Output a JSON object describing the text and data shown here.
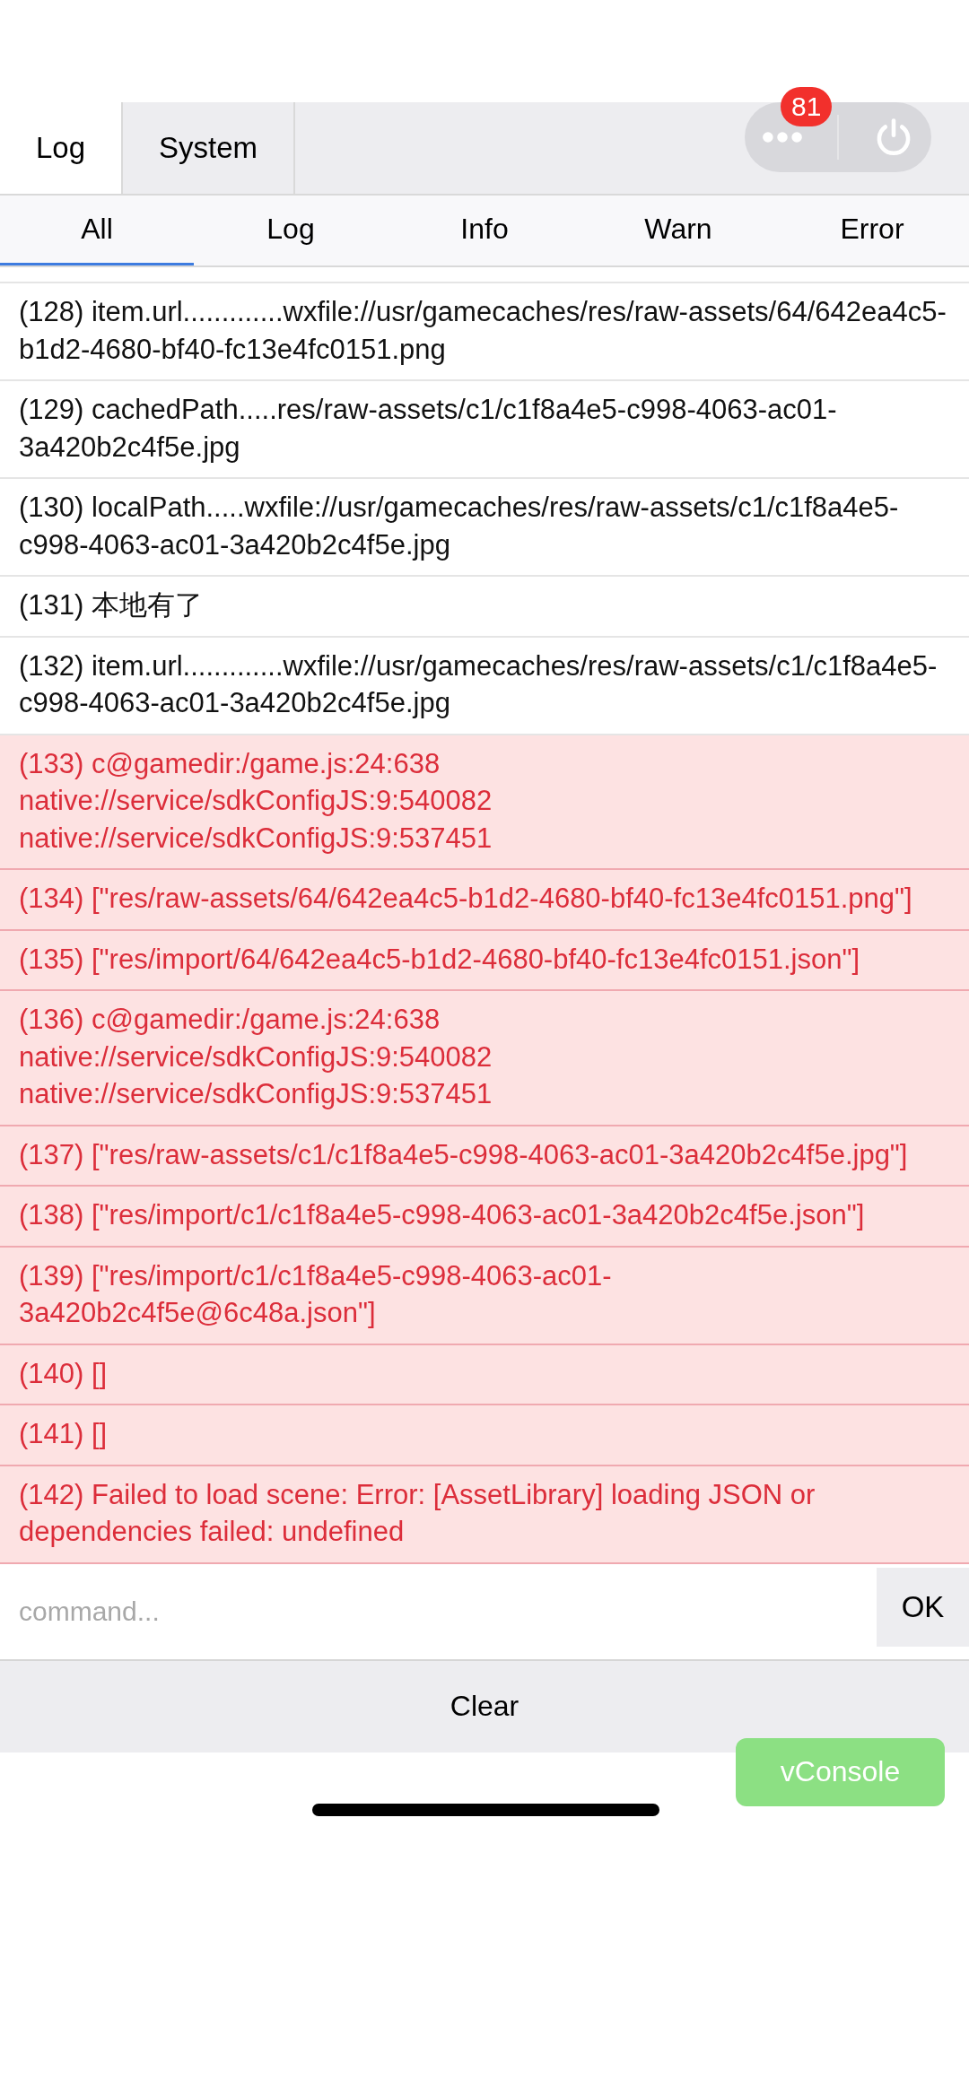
{
  "top_tabs": [
    {
      "label": "Log",
      "selected": true
    },
    {
      "label": "System",
      "selected": false
    }
  ],
  "badge": "81",
  "filter_tabs": [
    {
      "label": "All",
      "selected": true
    },
    {
      "label": "Log",
      "selected": false
    },
    {
      "label": "Info",
      "selected": false
    },
    {
      "label": "Warn",
      "selected": false
    },
    {
      "label": "Error",
      "selected": false
    }
  ],
  "log_entries": [
    {
      "kind": "log",
      "text": "(128) item.url.............wxfile://usr/gamecaches/res/raw-assets/64/642ea4c5-b1d2-4680-bf40-fc13e4fc0151.png"
    },
    {
      "kind": "log",
      "text": "(129) cachedPath.....res/raw-assets/c1/c1f8a4e5-c998-4063-ac01-3a420b2c4f5e.jpg"
    },
    {
      "kind": "log",
      "text": "(130) localPath.....wxfile://usr/gamecaches/res/raw-assets/c1/c1f8a4e5-c998-4063-ac01-3a420b2c4f5e.jpg"
    },
    {
      "kind": "log",
      "text": "(131) 本地有了"
    },
    {
      "kind": "log",
      "text": "(132) item.url.............wxfile://usr/gamecaches/res/raw-assets/c1/c1f8a4e5-c998-4063-ac01-3a420b2c4f5e.jpg"
    },
    {
      "kind": "error",
      "text": "(133) c@gamedir:/game.js:24:638\nnative://service/sdkConfigJS:9:540082\nnative://service/sdkConfigJS:9:537451"
    },
    {
      "kind": "error",
      "text": "(134) [\"res/raw-assets/64/642ea4c5-b1d2-4680-bf40-fc13e4fc0151.png\"]"
    },
    {
      "kind": "error",
      "text": "(135) [\"res/import/64/642ea4c5-b1d2-4680-bf40-fc13e4fc0151.json\"]"
    },
    {
      "kind": "error",
      "text": "(136) c@gamedir:/game.js:24:638\nnative://service/sdkConfigJS:9:540082\nnative://service/sdkConfigJS:9:537451"
    },
    {
      "kind": "error",
      "text": "(137) [\"res/raw-assets/c1/c1f8a4e5-c998-4063-ac01-3a420b2c4f5e.jpg\"]"
    },
    {
      "kind": "error",
      "text": "(138) [\"res/import/c1/c1f8a4e5-c998-4063-ac01-3a420b2c4f5e.json\"]"
    },
    {
      "kind": "error",
      "text": "(139) [\"res/import/c1/c1f8a4e5-c998-4063-ac01-3a420b2c4f5e@6c48a.json\"]"
    },
    {
      "kind": "error",
      "text": "(140) []"
    },
    {
      "kind": "error",
      "text": "(141) []"
    },
    {
      "kind": "error",
      "text": "(142) Failed to load scene: Error: [AssetLibrary] loading JSON or dependencies failed: undefined"
    }
  ],
  "command": {
    "placeholder": "command..."
  },
  "ok_button": "OK",
  "clear_button": "Clear",
  "vconsole_button": "vConsole"
}
